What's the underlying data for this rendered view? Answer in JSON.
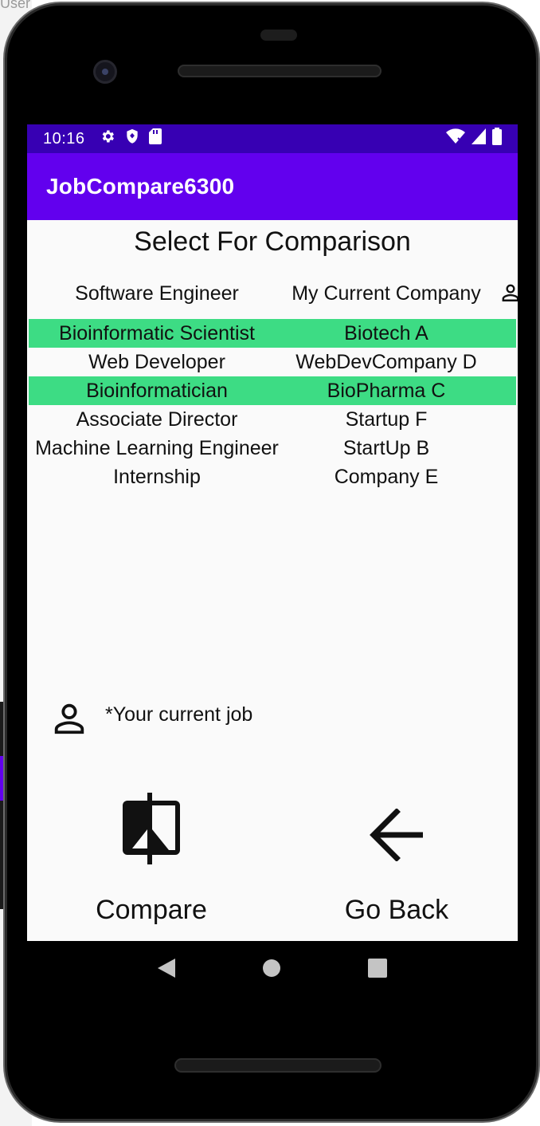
{
  "background": {
    "top_text": "User"
  },
  "status_bar": {
    "time": "10:16"
  },
  "app_bar": {
    "title": "JobCompare6300"
  },
  "screen": {
    "heading": "Select For Comparison"
  },
  "current_job": {
    "title": "Software Engineer",
    "company": "My Current Company"
  },
  "jobs": [
    {
      "title": "Bioinformatic Scientist",
      "company": "Biotech A",
      "selected": true
    },
    {
      "title": "Web Developer",
      "company": "WebDevCompany D",
      "selected": false
    },
    {
      "title": "Bioinformatician",
      "company": "BioPharma C",
      "selected": true
    },
    {
      "title": "Associate Director",
      "company": "Startup F",
      "selected": false
    },
    {
      "title": "Machine Learning Engineer",
      "company": "StartUp B",
      "selected": false
    },
    {
      "title": "Internship",
      "company": "Company E",
      "selected": false
    }
  ],
  "legend": {
    "text": "*Your current job",
    "icon": "person-icon"
  },
  "actions": {
    "compare_label": "Compare",
    "compare_icon": "compare-icon",
    "back_label": "Go Back",
    "back_icon": "arrow-back-icon"
  },
  "colors": {
    "status_bar": "#3700b3",
    "app_bar": "#6200ee",
    "selected_row": "#3ddc84",
    "screen_bg": "#fafafa"
  }
}
